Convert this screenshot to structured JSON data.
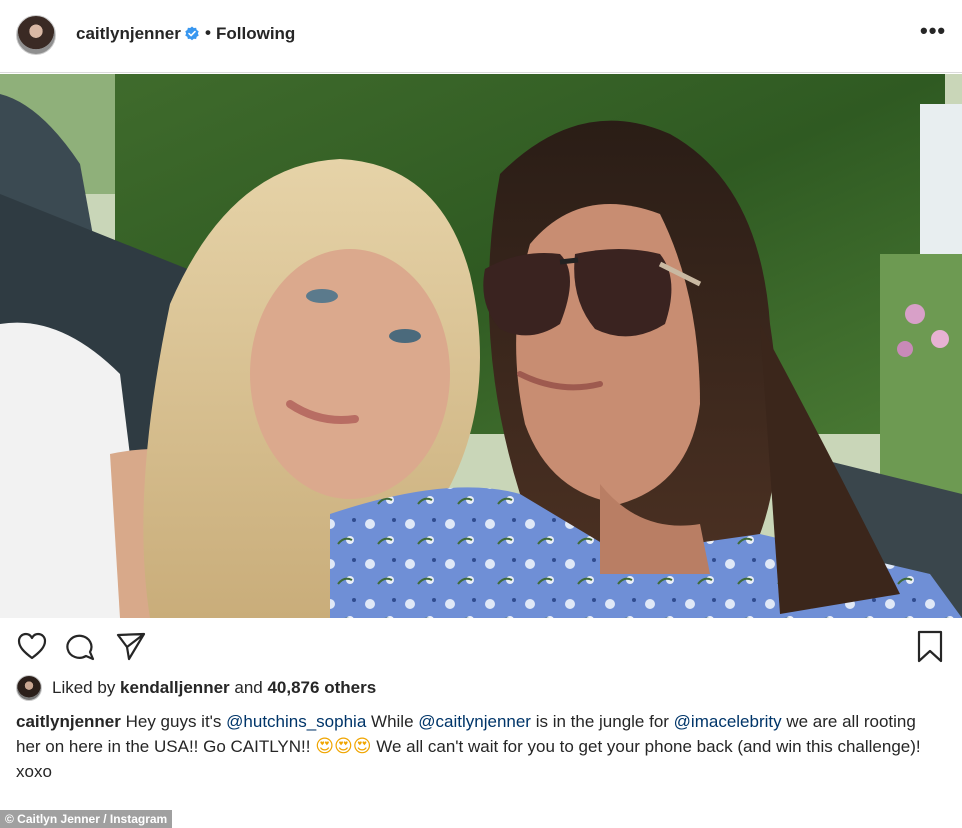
{
  "header": {
    "username": "caitlynjenner",
    "separator": "•",
    "follow_status": "Following",
    "more_label": "•••"
  },
  "post": {
    "likes": {
      "prefix": "Liked by ",
      "liker": "kendalljenner",
      "middle": " and ",
      "count_text": "40,876 others"
    },
    "caption": {
      "author": "caitlynjenner",
      "t1": " Hey guys it's ",
      "m1": "@hutchins_sophia",
      "t2": " While ",
      "m2": "@caitlynjenner",
      "t3": " is in the jungle for ",
      "m3": "@imacelebrity",
      "t4": " we are all rooting her on here in the USA!! Go CAITLYN!! ",
      "emojis": "😍😍😍",
      "t5": " We all can't wait for you to get your phone back (and win this challenge)! xoxo"
    }
  },
  "credit": "© Caitlyn Jenner / Instagram",
  "icons": [
    "heart-icon",
    "comment-icon",
    "share-icon",
    "bookmark-icon",
    "verified-badge-icon"
  ],
  "colors": {
    "verified": "#3897f0",
    "mention": "#003569",
    "text": "#262626"
  }
}
